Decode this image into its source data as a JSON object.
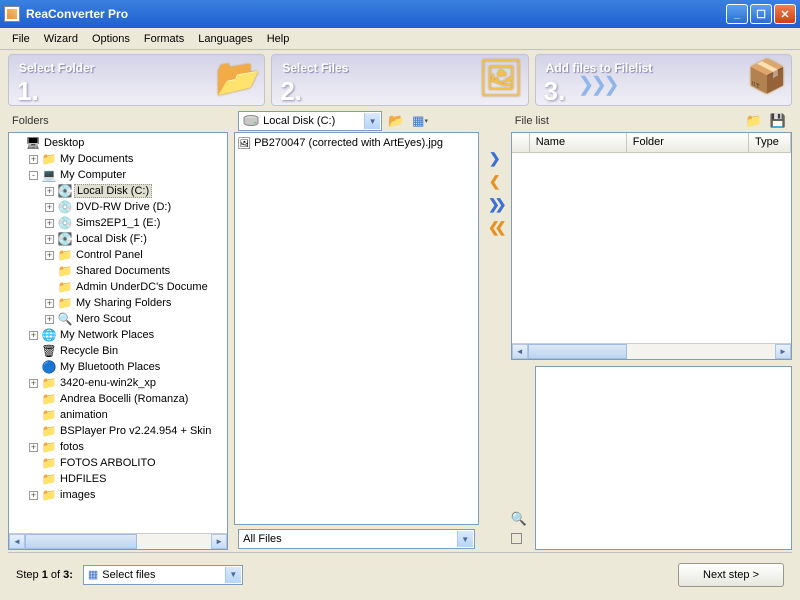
{
  "window": {
    "title": "ReaConverter Pro"
  },
  "menu": [
    "File",
    "Wizard",
    "Options",
    "Formats",
    "Languages",
    "Help"
  ],
  "steps": [
    {
      "num": "1.",
      "label": "Select Folder"
    },
    {
      "num": "2.",
      "label": "Select Files"
    },
    {
      "num": "3.",
      "label": "Add files to Filelist"
    }
  ],
  "foldersLabel": "Folders",
  "driveSelected": "Local Disk (C:)",
  "fileFilter": "All Files",
  "fileListLabel": "File list",
  "columns": {
    "name": "Name",
    "folder": "Folder",
    "type": "Type"
  },
  "tree": [
    {
      "indent": 0,
      "exp": "",
      "icon": "🖥",
      "label": "Desktop"
    },
    {
      "indent": 1,
      "exp": "+",
      "icon": "📁",
      "label": "My Documents"
    },
    {
      "indent": 1,
      "exp": "-",
      "icon": "💻",
      "label": "My Computer"
    },
    {
      "indent": 2,
      "exp": "+",
      "icon": "💽",
      "label": "Local Disk (C:)",
      "sel": true
    },
    {
      "indent": 2,
      "exp": "+",
      "icon": "💿",
      "label": "DVD-RW Drive (D:)"
    },
    {
      "indent": 2,
      "exp": "+",
      "icon": "💿",
      "label": "Sims2EP1_1 (E:)"
    },
    {
      "indent": 2,
      "exp": "+",
      "icon": "💽",
      "label": "Local Disk (F:)"
    },
    {
      "indent": 2,
      "exp": "+",
      "icon": "📁",
      "label": "Control Panel"
    },
    {
      "indent": 2,
      "exp": "",
      "icon": "📁",
      "label": "Shared Documents"
    },
    {
      "indent": 2,
      "exp": "",
      "icon": "📁",
      "label": "Admin UnderDC's Docume"
    },
    {
      "indent": 2,
      "exp": "+",
      "icon": "📁",
      "label": "My Sharing Folders"
    },
    {
      "indent": 2,
      "exp": "+",
      "icon": "🔍",
      "label": "Nero Scout"
    },
    {
      "indent": 1,
      "exp": "+",
      "icon": "🌐",
      "label": "My Network Places"
    },
    {
      "indent": 1,
      "exp": "",
      "icon": "🗑",
      "label": "Recycle Bin"
    },
    {
      "indent": 1,
      "exp": "",
      "icon": "🔵",
      "label": "My Bluetooth Places"
    },
    {
      "indent": 1,
      "exp": "+",
      "icon": "📁",
      "label": "3420-enu-win2k_xp"
    },
    {
      "indent": 1,
      "exp": "",
      "icon": "📁",
      "label": "Andrea Bocelli (Romanza)"
    },
    {
      "indent": 1,
      "exp": "",
      "icon": "📁",
      "label": "animation"
    },
    {
      "indent": 1,
      "exp": "",
      "icon": "📁",
      "label": "BSPlayer Pro v2.24.954 + Skin"
    },
    {
      "indent": 1,
      "exp": "+",
      "icon": "📁",
      "label": "fotos"
    },
    {
      "indent": 1,
      "exp": "",
      "icon": "📁",
      "label": "FOTOS ARBOLITO"
    },
    {
      "indent": 1,
      "exp": "",
      "icon": "📁",
      "label": "HDFILES"
    },
    {
      "indent": 1,
      "exp": "+",
      "icon": "📁",
      "label": "images"
    }
  ],
  "files": [
    {
      "icon": "🖼",
      "name": "PB270047 (corrected with ArtEyes).jpg"
    }
  ],
  "footer": {
    "stepText": "Step 1 of 3:",
    "stepSel": "Select files",
    "next": "Next step >"
  }
}
